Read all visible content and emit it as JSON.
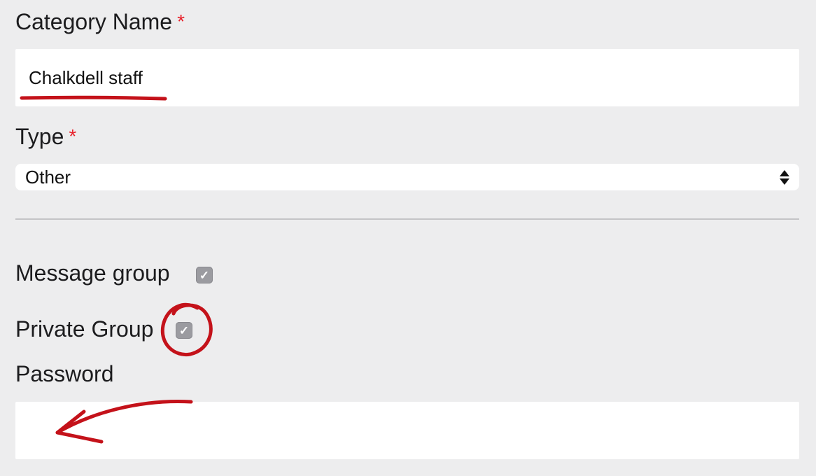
{
  "form": {
    "category_name": {
      "label": "Category Name",
      "required_mark": "*",
      "value": "Chalkdell staff"
    },
    "type": {
      "label": "Type",
      "required_mark": "*",
      "selected": "Other"
    },
    "message_group": {
      "label": "Message group",
      "checked": true,
      "check_glyph": "✓"
    },
    "private_group": {
      "label": "Private Group",
      "checked": true,
      "check_glyph": "✓"
    },
    "password": {
      "label": "Password",
      "value": ""
    }
  },
  "icons": {
    "select_arrows": "chevron-updown-icon",
    "checkbox": "checkmark-icon"
  },
  "colors": {
    "background": "#ededee",
    "required": "#e8202a",
    "checkbox": "#9b9ba0",
    "annotation": "#c4121a"
  }
}
